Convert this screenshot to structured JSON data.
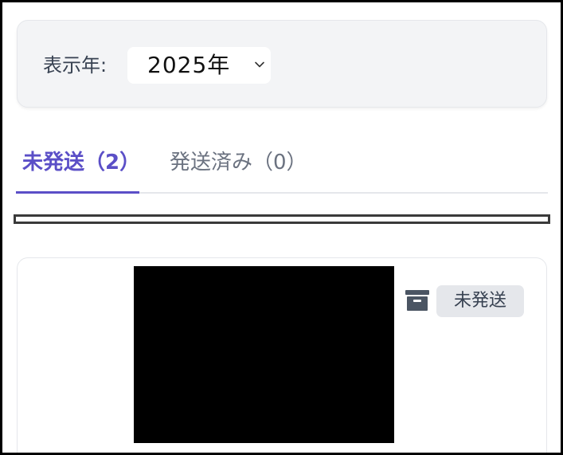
{
  "filter": {
    "year_label": "表示年:",
    "year_value": "2025年"
  },
  "tabs": [
    {
      "label": "未発送（2）",
      "active": true
    },
    {
      "label": "発送済み（0）",
      "active": false
    }
  ],
  "item": {
    "status": "未発送"
  },
  "colors": {
    "accent": "#5b4fc7",
    "card_bg": "#f3f4f6",
    "badge_bg": "#e5e7eb"
  },
  "icons": {
    "select_chevron": "chevron-down-icon",
    "archive": "archive-box-icon"
  }
}
